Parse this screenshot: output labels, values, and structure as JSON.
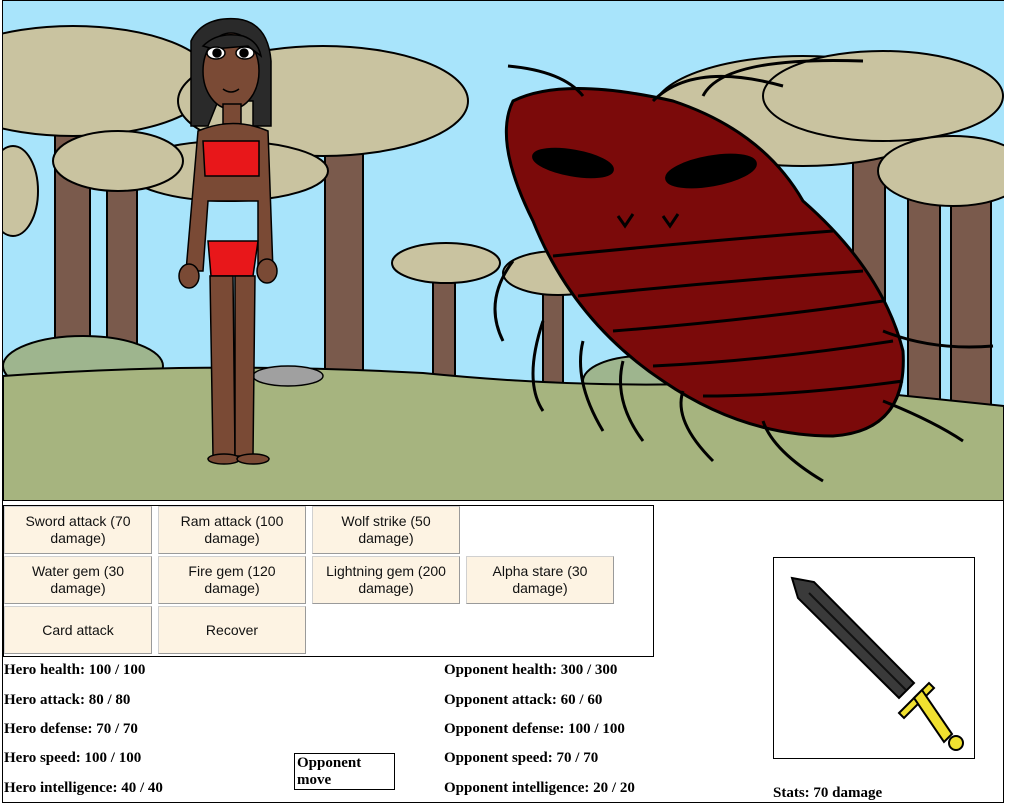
{
  "actions": {
    "row1": [
      {
        "label": "Sword attack (70 damage)"
      },
      {
        "label": "Ram attack (100 damage)"
      },
      {
        "label": "Wolf strike (50 damage)"
      }
    ],
    "row2": [
      {
        "label": "Water gem (30 damage)"
      },
      {
        "label": "Fire gem (120 damage)"
      },
      {
        "label": "Lightning gem (200 damage)"
      },
      {
        "label": "Alpha stare (30 damage)"
      }
    ],
    "row3": [
      {
        "label": "Card attack"
      },
      {
        "label": "Recover"
      }
    ]
  },
  "hero_stats": {
    "health": "Hero health: 100 / 100",
    "attack": "Hero attack: 80 / 80",
    "defense": "Hero defense: 70 / 70",
    "speed": "Hero speed: 100 / 100",
    "intelligence": "Hero intelligence: 40 / 40"
  },
  "opponent_stats": {
    "health": "Opponent health: 300 / 300",
    "attack": "Opponent attack: 60 / 60",
    "defense": "Opponent defense: 100 / 100",
    "speed": "Opponent speed: 70 / 70",
    "intelligence": "Opponent intelligence: 20 / 20"
  },
  "opponent_move_label": "Opponent move",
  "item": {
    "icon": "sword-icon",
    "stats": "Stats: 70 damage"
  },
  "colors": {
    "sky": "#a8e4fb",
    "ground": "#a6b47f",
    "tree_cap": "#c9c3a0",
    "trunk": "#7a5a4c",
    "creature": "#7b0a0a",
    "button_bg": "#fdf3e3"
  }
}
